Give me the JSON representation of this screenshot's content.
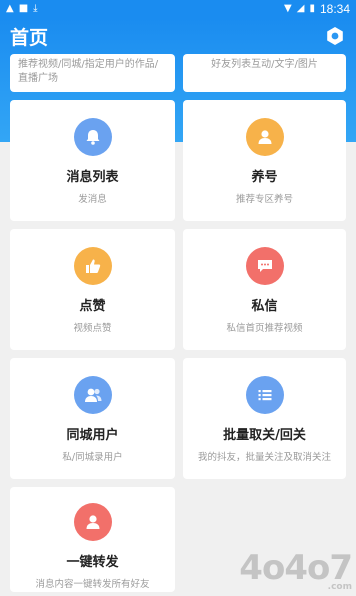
{
  "status_bar": {
    "time": "18:34"
  },
  "header": {
    "title": "首页"
  },
  "top_cards": [
    {
      "text": "推荐视频/同城/指定用户的作品/直播广场"
    },
    {
      "text": "好友列表互动/文字/图片"
    }
  ],
  "cards": [
    {
      "title": "消息列表",
      "subtitle": "发消息",
      "icon": "bell-icon",
      "color": "#6aa2f0"
    },
    {
      "title": "养号",
      "subtitle": "推荐专区养号",
      "icon": "user-icon",
      "color": "#f7b24a"
    },
    {
      "title": "点赞",
      "subtitle": "视频点赞",
      "icon": "thumbs-up-icon",
      "color": "#f7b24a"
    },
    {
      "title": "私信",
      "subtitle": "私信首页推荐视频",
      "icon": "message-icon",
      "color": "#f2706a"
    },
    {
      "title": "同城用户",
      "subtitle": "私/同城录用户",
      "icon": "users-icon",
      "color": "#6aa2f0"
    },
    {
      "title": "批量取关/回关",
      "subtitle": "我的抖友，批量关注及取消关注",
      "icon": "list-icon",
      "color": "#6aa2f0"
    },
    {
      "title": "一键转发",
      "subtitle": "消息内容一键转发所有好友",
      "icon": "user-icon",
      "color": "#f2706a"
    }
  ],
  "watermark": {
    "text": "4o4o7",
    "sub": ".com"
  }
}
